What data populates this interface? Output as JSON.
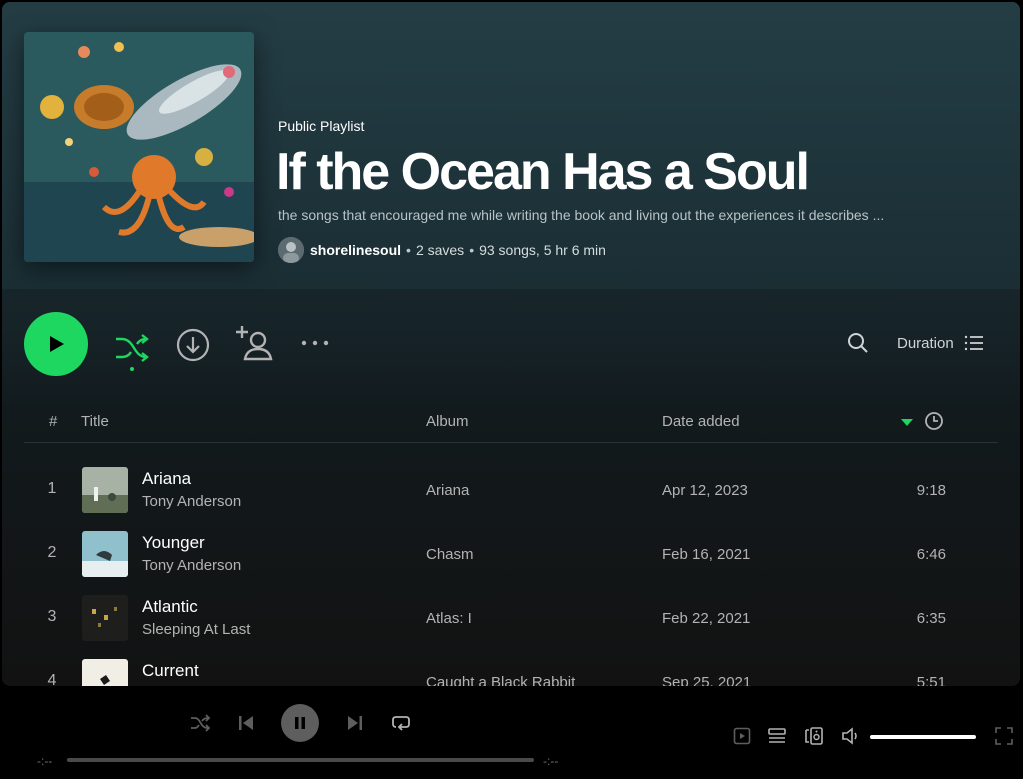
{
  "playlist": {
    "type": "Public Playlist",
    "title": "If the Ocean Has a Soul",
    "description": "the songs that encouraged me while writing the book and living out the experiences it describes ...",
    "owner": "shorelinesoul",
    "saves": "2 saves",
    "stats": "93 songs, 5 hr 6 min"
  },
  "controls": {
    "sort_label": "Duration",
    "icons": [
      "play-icon",
      "shuffle-icon",
      "download-icon",
      "add-user-icon",
      "more-icon",
      "search-icon",
      "list-icon"
    ]
  },
  "table": {
    "headers": {
      "num": "#",
      "title": "Title",
      "album": "Album",
      "date": "Date added"
    },
    "rows": [
      {
        "num": "1",
        "title": "Ariana",
        "artist": "Tony Anderson",
        "album": "Ariana",
        "date": "Apr 12, 2023",
        "duration": "9:18"
      },
      {
        "num": "2",
        "title": "Younger",
        "artist": "Tony Anderson",
        "album": "Chasm",
        "date": "Feb 16, 2021",
        "duration": "6:46"
      },
      {
        "num": "3",
        "title": "Atlantic",
        "artist": "Sleeping At Last",
        "album": "Atlas: I",
        "date": "Feb 22, 2021",
        "duration": "6:35"
      },
      {
        "num": "4",
        "title": "Current",
        "artist": "",
        "album": "Caught a Black Rabbit",
        "date": "Sep 25, 2021",
        "duration": "5:51"
      }
    ]
  },
  "player": {
    "elapsed": "-:--",
    "remaining": "-:--",
    "volume_fraction": 1.0
  },
  "colors": {
    "accent": "#1ed760",
    "header_bg": "#243d45",
    "background": "#121212"
  }
}
